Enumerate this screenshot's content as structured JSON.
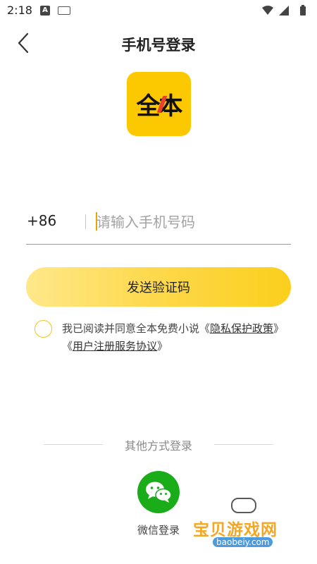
{
  "status_bar": {
    "time": "2:18",
    "a_icon": "A"
  },
  "header": {
    "title": "手机号登录"
  },
  "logo": {
    "text": "全本",
    "color": "#fcc900"
  },
  "phone": {
    "country_code": "+86",
    "placeholder": "请输入手机号码",
    "value": ""
  },
  "send_button": {
    "label": "发送验证码"
  },
  "agreement": {
    "prefix": "我已阅读并同意全本免费小说《",
    "privacy_link": "隐私保护政策",
    "middle": "》《",
    "terms_link": "用户注册服务协议",
    "suffix": "》",
    "checked": false
  },
  "other_login": {
    "label": "其他方式登录",
    "wechat_label": "微信登录"
  },
  "watermark": {
    "text": "宝贝游戏网",
    "url": "baobeiy.com"
  },
  "colors": {
    "accent": "#fcc900",
    "wechat": "#1aad19"
  }
}
